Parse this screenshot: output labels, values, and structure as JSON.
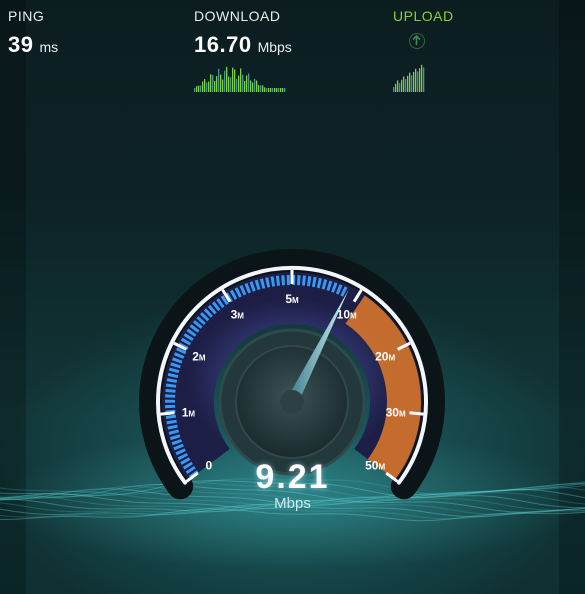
{
  "ping": {
    "label": "PING",
    "value": "39",
    "unit": "ms"
  },
  "download": {
    "label": "DOWNLOAD",
    "value": "16.70",
    "unit": "Mbps"
  },
  "upload": {
    "label": "UPLOAD",
    "icon": "upload-arrow-icon"
  },
  "gauge": {
    "current_value": "9.21",
    "current_numeric": 9.21,
    "unit": "Mbps",
    "scale_labels": [
      {
        "main": "0",
        "suffix": ""
      },
      {
        "main": "1",
        "suffix": "M"
      },
      {
        "main": "2",
        "suffix": "M"
      },
      {
        "main": "3",
        "suffix": "M"
      },
      {
        "main": "5",
        "suffix": "M"
      },
      {
        "main": "10",
        "suffix": "M"
      },
      {
        "main": "20",
        "suffix": "M"
      },
      {
        "main": "30",
        "suffix": "M"
      },
      {
        "main": "50",
        "suffix": "M"
      }
    ],
    "scale_values": [
      0,
      1,
      2,
      3,
      5,
      10,
      20,
      30,
      50
    ]
  },
  "colors": {
    "background": "#0d2326",
    "upload_accent": "#8bd32f",
    "gauge_blue": "#3aa0ff",
    "gauge_orange": "#e07a2a",
    "needle": "#bff4ff"
  }
}
